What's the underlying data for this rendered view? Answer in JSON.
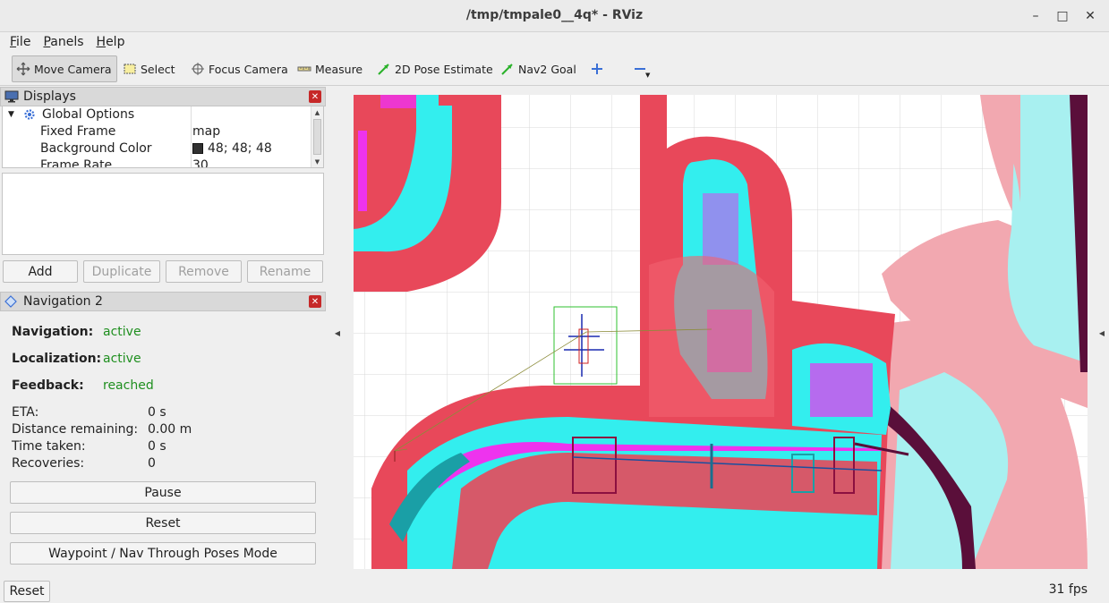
{
  "window": {
    "title": "/tmp/tmpale0__4q* - RViz"
  },
  "menu": [
    "File",
    "Panels",
    "Help"
  ],
  "toolbar": {
    "move_camera": "Move Camera",
    "select": "Select",
    "focus_camera": "Focus Camera",
    "measure": "Measure",
    "pose_estimate": "2D Pose Estimate",
    "nav2_goal": "Nav2 Goal"
  },
  "displays": {
    "title": "Displays",
    "global_options": "Global Options",
    "rows": [
      {
        "name": "Fixed Frame",
        "value": "map"
      },
      {
        "name": "Background Color",
        "value": "48; 48; 48"
      },
      {
        "name": "Frame Rate",
        "value": "30"
      }
    ],
    "buttons": {
      "add": "Add",
      "duplicate": "Duplicate",
      "remove": "Remove",
      "rename": "Rename"
    },
    "bg_color_swatch": "#303030"
  },
  "navigation": {
    "title": "Navigation 2",
    "navigation_label": "Navigation:",
    "navigation_value": "active",
    "localization_label": "Localization:",
    "localization_value": "active",
    "feedback_label": "Feedback:",
    "feedback_value": "reached",
    "eta_label": "ETA:",
    "eta_value": "0 s",
    "distance_label": "Distance remaining:",
    "distance_value": "0.00 m",
    "time_label": "Time taken:",
    "time_value": "0 s",
    "recoveries_label": "Recoveries:",
    "recoveries_value": "0",
    "pause": "Pause",
    "reset": "Reset",
    "waypoint": "Waypoint / Nav Through Poses Mode"
  },
  "status": {
    "reset": "Reset",
    "fps": "31 fps"
  },
  "colors": {
    "active_green": "#1f8f1f",
    "cost_red": "#e8485a",
    "cost_cyan": "#33eeee",
    "cost_magenta": "#ee33ee",
    "cost_pink": "#f2a8b0"
  }
}
